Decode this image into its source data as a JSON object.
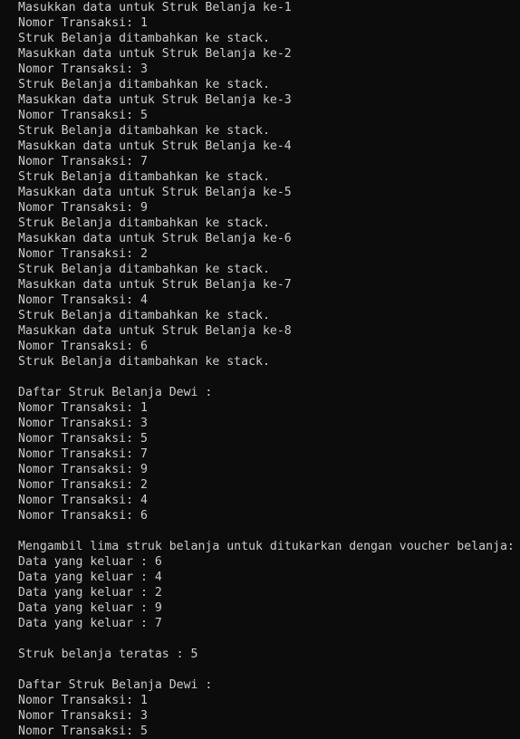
{
  "console": {
    "lines": [
      "Masukkan data untuk Struk Belanja ke-1",
      "Nomor Transaksi: 1",
      "Struk Belanja ditambahkan ke stack.",
      "Masukkan data untuk Struk Belanja ke-2",
      "Nomor Transaksi: 3",
      "Struk Belanja ditambahkan ke stack.",
      "Masukkan data untuk Struk Belanja ke-3",
      "Nomor Transaksi: 5",
      "Struk Belanja ditambahkan ke stack.",
      "Masukkan data untuk Struk Belanja ke-4",
      "Nomor Transaksi: 7",
      "Struk Belanja ditambahkan ke stack.",
      "Masukkan data untuk Struk Belanja ke-5",
      "Nomor Transaksi: 9",
      "Struk Belanja ditambahkan ke stack.",
      "Masukkan data untuk Struk Belanja ke-6",
      "Nomor Transaksi: 2",
      "Struk Belanja ditambahkan ke stack.",
      "Masukkan data untuk Struk Belanja ke-7",
      "Nomor Transaksi: 4",
      "Struk Belanja ditambahkan ke stack.",
      "Masukkan data untuk Struk Belanja ke-8",
      "Nomor Transaksi: 6",
      "Struk Belanja ditambahkan ke stack.",
      "",
      "Daftar Struk Belanja Dewi :",
      "Nomor Transaksi: 1",
      "Nomor Transaksi: 3",
      "Nomor Transaksi: 5",
      "Nomor Transaksi: 7",
      "Nomor Transaksi: 9",
      "Nomor Transaksi: 2",
      "Nomor Transaksi: 4",
      "Nomor Transaksi: 6",
      "",
      "Mengambil lima struk belanja untuk ditukarkan dengan voucher belanja:",
      "Data yang keluar : 6",
      "Data yang keluar : 4",
      "Data yang keluar : 2",
      "Data yang keluar : 9",
      "Data yang keluar : 7",
      "",
      "Struk belanja teratas : 5",
      "",
      "Daftar Struk Belanja Dewi :",
      "Nomor Transaksi: 1",
      "Nomor Transaksi: 3",
      "Nomor Transaksi: 5"
    ]
  },
  "colors": {
    "background": "#0c0c0c",
    "text": "#cccccc"
  }
}
